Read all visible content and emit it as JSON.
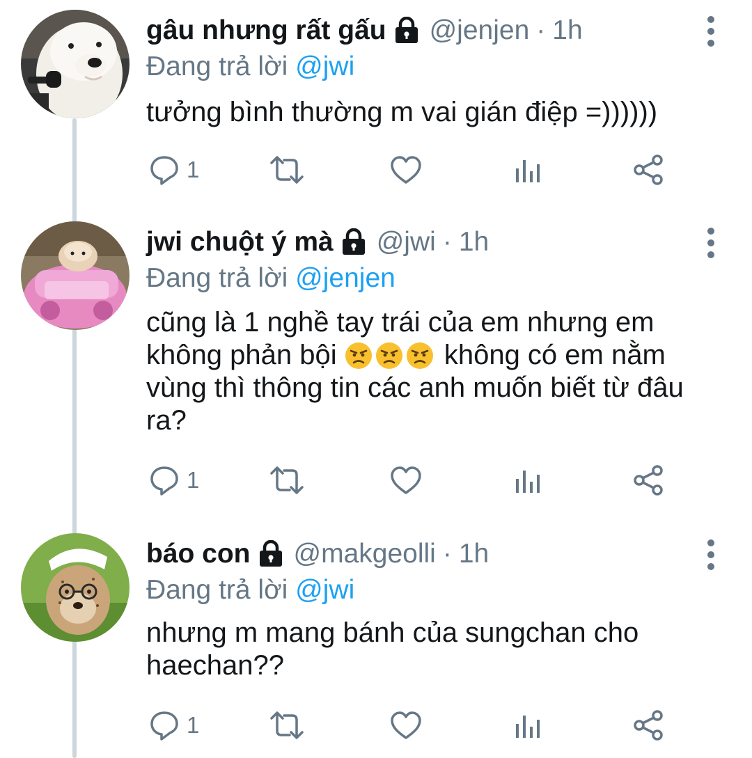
{
  "tweets": [
    {
      "name": "gâu nhưng rất gấu",
      "handle": "@jenjen",
      "dot": "·",
      "time": "1h",
      "replying_prefix": "Đang trả lời",
      "replying_to": "@jwi",
      "text": "tưởng bình thường m vai gián điệp =))))))",
      "reply_count": "1",
      "avatar": "white-dog-avatar"
    },
    {
      "name": "jwi chuột ý mà",
      "handle": "@jwi",
      "dot": "·",
      "time": "1h",
      "replying_prefix": "Đang trả lời",
      "replying_to": "@jenjen",
      "text_before_emoji": "cũng là 1 nghề tay trái của em nhưng em không phản bội",
      "text_after_emoji": "không có em nằm vùng thì thông tin các anh muốn biết từ đâu ra?",
      "emoji": [
        "angry-face",
        "angry-face",
        "angry-face"
      ],
      "reply_count": "1",
      "avatar": "hamster-pink-car-avatar"
    },
    {
      "name": "báo con",
      "handle": "@makgeolli",
      "dot": "·",
      "time": "1h",
      "replying_prefix": "Đang trả lời",
      "replying_to": "@jwi",
      "text": "nhưng m mang bánh của sungchan cho haechan??",
      "reply_count": "1",
      "avatar": "cheetah-cub-avatar"
    }
  ],
  "icons": {
    "reply": "reply-icon",
    "retweet": "retweet-icon",
    "like": "heart-icon",
    "analytics": "analytics-icon",
    "share": "share-icon",
    "lock": "lock-icon",
    "more": "more-vertical-icon"
  },
  "colors": {
    "text": "#14171a",
    "secondary": "#657786",
    "link": "#1da1f2",
    "thread_line": "#ccd6dd"
  }
}
